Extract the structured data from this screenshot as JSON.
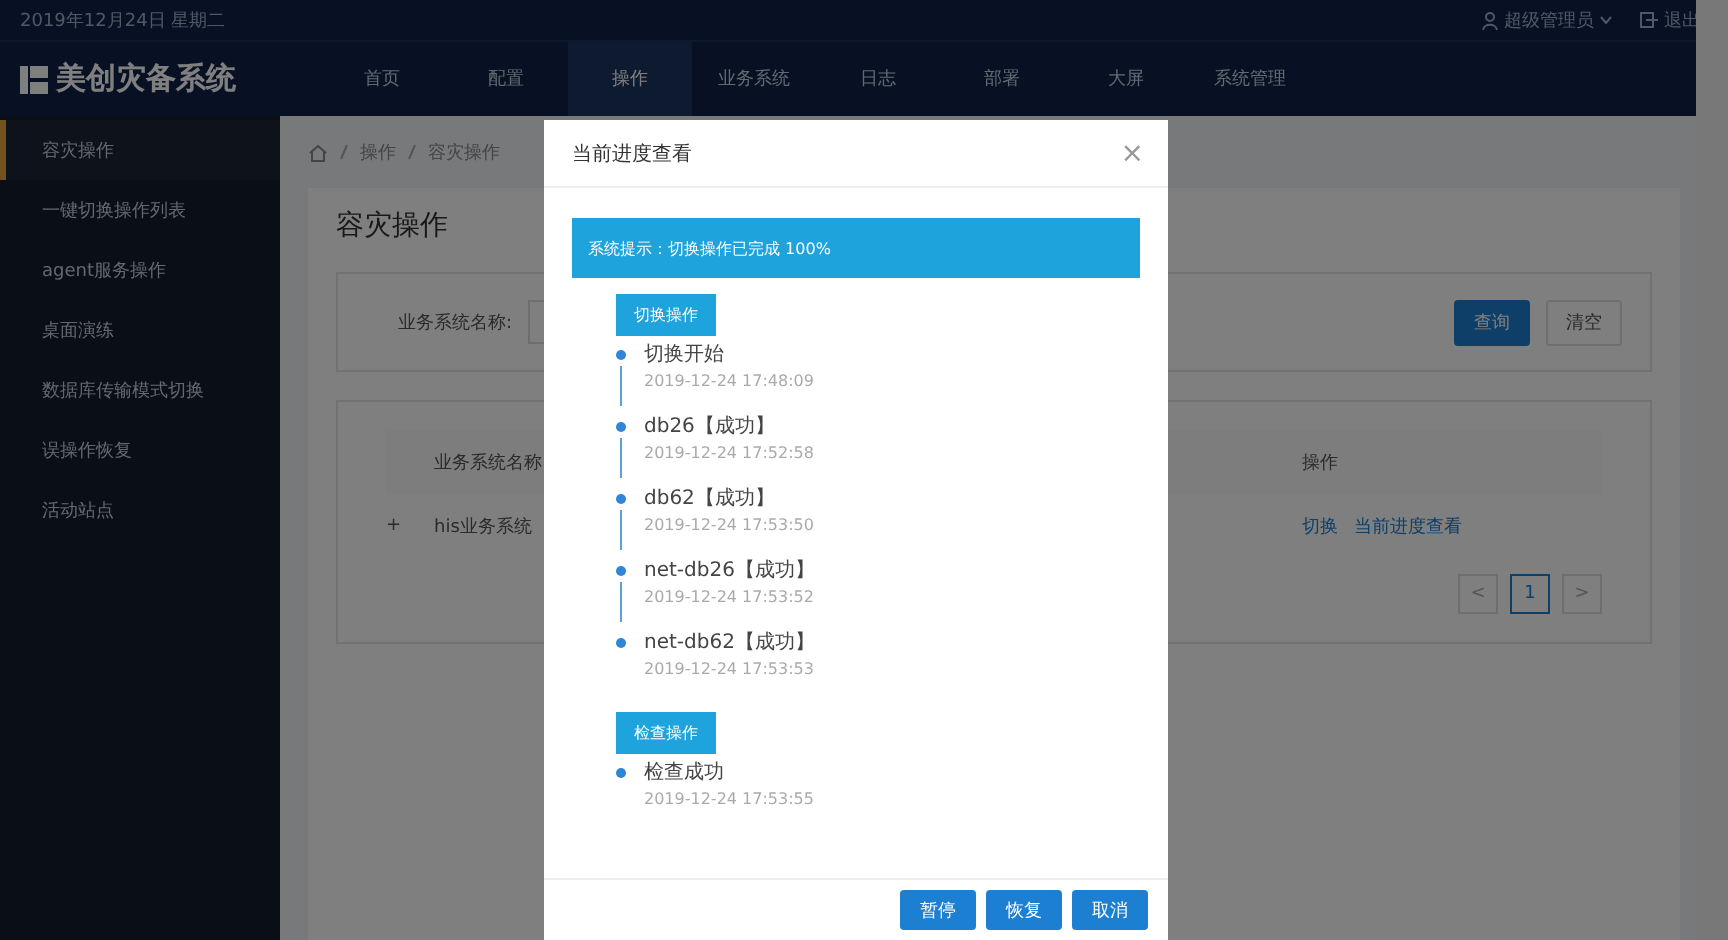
{
  "top_bar": {
    "date": "2019年12月24日 星期二",
    "user": "超级管理员",
    "logout": "退出"
  },
  "nav": {
    "logo": "美创灾备系统",
    "items": [
      {
        "label": "首页",
        "selected": false
      },
      {
        "label": "配置",
        "selected": false
      },
      {
        "label": "操作",
        "selected": true
      },
      {
        "label": "业务系统",
        "selected": false
      },
      {
        "label": "日志",
        "selected": false
      },
      {
        "label": "部署",
        "selected": false
      },
      {
        "label": "大屏",
        "selected": false
      },
      {
        "label": "系统管理",
        "selected": false
      }
    ]
  },
  "sidebar": {
    "items": [
      {
        "label": "容灾操作",
        "selected": true
      },
      {
        "label": "一键切换操作列表",
        "selected": false
      },
      {
        "label": "agent服务操作",
        "selected": false
      },
      {
        "label": "桌面演练",
        "selected": false
      },
      {
        "label": "数据库传输模式切换",
        "selected": false
      },
      {
        "label": "误操作恢复",
        "selected": false
      },
      {
        "label": "活动站点",
        "selected": false
      }
    ]
  },
  "breadcrumb": [
    "操作",
    "容灾操作"
  ],
  "page_title": "容灾操作",
  "search": {
    "label": "业务系统名称:",
    "query_button": "查询",
    "clear_button": "清空"
  },
  "table": {
    "columns": [
      "业务系统名称",
      "操作"
    ],
    "rows": [
      {
        "expand": "+",
        "system": "his业务系统",
        "actions": [
          "切换",
          "当前进度查看"
        ]
      }
    ]
  },
  "pagination": {
    "prev": "<",
    "page": "1",
    "next": ">"
  },
  "modal": {
    "title": "当前进度查看",
    "close": "×",
    "alert": "系统提示：切换操作已完成 100%",
    "groups": [
      {
        "label": "切换操作",
        "events": [
          {
            "text": "切换开始",
            "time": "2019-12-24 17:48:09"
          },
          {
            "text": "db26【成功】",
            "time": "2019-12-24 17:52:58"
          },
          {
            "text": "db62【成功】",
            "time": "2019-12-24 17:53:50"
          },
          {
            "text": "net-db26【成功】",
            "time": "2019-12-24 17:53:52"
          },
          {
            "text": "net-db62【成功】",
            "time": "2019-12-24 17:53:53"
          }
        ]
      },
      {
        "label": "检查操作",
        "events": [
          {
            "text": "检查成功",
            "time": "2019-12-24 17:53:55"
          }
        ]
      }
    ],
    "buttons": [
      "暂停",
      "恢复",
      "取消"
    ]
  }
}
